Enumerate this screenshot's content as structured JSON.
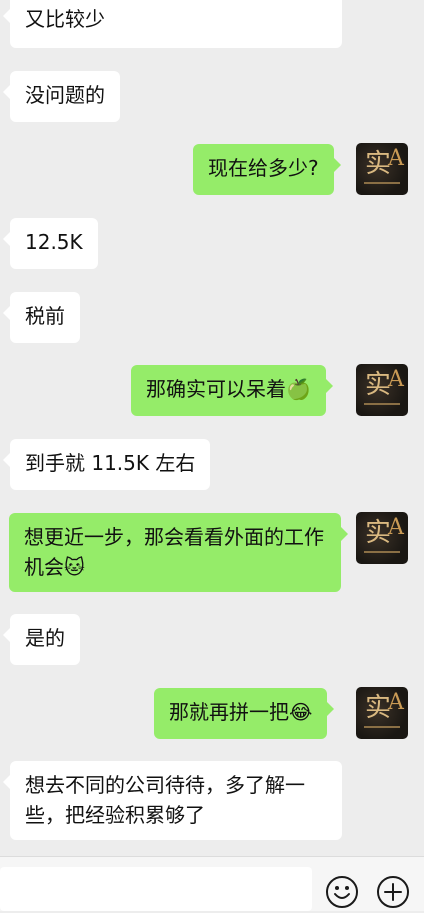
{
  "conversation": {
    "messages": [
      {
        "side": "in",
        "text": "又比较少"
      },
      {
        "side": "in",
        "text": "没问题的"
      },
      {
        "side": "out",
        "text": "现在给多少?"
      },
      {
        "side": "in",
        "text": "12.5K"
      },
      {
        "side": "in",
        "text": "税前"
      },
      {
        "side": "out",
        "text": "那确实可以呆着🍏"
      },
      {
        "side": "in",
        "text": "到手就 11.5K 左右"
      },
      {
        "side": "out",
        "text": "想更近一步，那会看看外面的工作机会🐱"
      },
      {
        "side": "in",
        "text": "是的"
      },
      {
        "side": "out",
        "text": "那就再拼一把😂"
      },
      {
        "side": "in",
        "text": "想去不同的公司待待，多了解一些，把经验积累够了"
      }
    ]
  },
  "contact": {
    "avatar_label_1": "实",
    "avatar_label_2": "A"
  },
  "input_bar": {
    "emoji_icon": "smile-icon",
    "plus_icon": "plus-icon"
  },
  "colors": {
    "background": "#ededed",
    "incoming_bubble": "#ffffff",
    "outgoing_bubble": "#95ec69"
  }
}
